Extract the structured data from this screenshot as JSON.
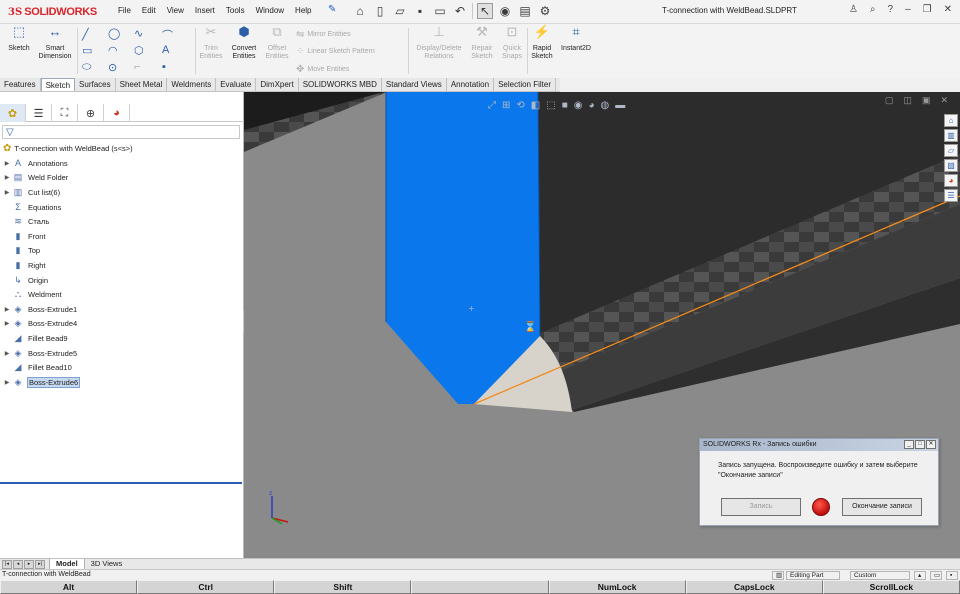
{
  "app": {
    "logo_prefix": "3S",
    "logo_text": "SOLIDWORKS",
    "document_title": "T-connection with WeldBead.SLDPRT"
  },
  "menu": [
    "File",
    "Edit",
    "View",
    "Insert",
    "Tools",
    "Window",
    "Help"
  ],
  "command_manager": {
    "sketch": "Sketch",
    "smart_dimension_1": "Smart",
    "smart_dimension_2": "Dimension",
    "trim_1": "Trim",
    "trim_2": "Entities",
    "convert_1": "Convert",
    "convert_2": "Entities",
    "offset_1": "Offset",
    "offset_2": "Entities",
    "mirror": "Mirror Entities",
    "linear_pattern": "Linear Sketch Pattern",
    "move": "Move Entities",
    "display_delete_1": "Display/Delete",
    "display_delete_2": "Relations",
    "repair_1": "Repair",
    "repair_2": "Sketch",
    "quick_snaps_1": "Quick",
    "quick_snaps_2": "Snaps",
    "rapid_1": "Rapid",
    "rapid_2": "Sketch",
    "instant2d": "Instant2D"
  },
  "tabs": [
    "Features",
    "Sketch",
    "Surfaces",
    "Sheet Metal",
    "Weldments",
    "Evaluate",
    "DimXpert",
    "SOLIDWORKS MBD",
    "Standard Views",
    "Annotation",
    "Selection Filter"
  ],
  "active_tab": "Sketch",
  "feature_tree": {
    "root": "T-connection with WeldBead  (s<s>)",
    "items": [
      {
        "label": "Annotations",
        "expandable": true,
        "icon": "annotations-icon"
      },
      {
        "label": "Weld Folder",
        "expandable": true,
        "icon": "weld-folder-icon"
      },
      {
        "label": "Cut list(6)",
        "expandable": true,
        "icon": "cut-list-icon"
      },
      {
        "label": "Equations",
        "expandable": false,
        "icon": "equations-icon"
      },
      {
        "label": "Сталь",
        "expandable": false,
        "icon": "material-icon"
      },
      {
        "label": "Front",
        "expandable": false,
        "icon": "plane-icon"
      },
      {
        "label": "Top",
        "expandable": false,
        "icon": "plane-icon"
      },
      {
        "label": "Right",
        "expandable": false,
        "icon": "plane-icon"
      },
      {
        "label": "Origin",
        "expandable": false,
        "icon": "origin-icon"
      },
      {
        "label": "Weldment",
        "expandable": false,
        "icon": "weldment-icon"
      },
      {
        "label": "Boss-Extrude1",
        "expandable": true,
        "icon": "extrude-icon"
      },
      {
        "label": "Boss-Extrude4",
        "expandable": true,
        "icon": "extrude-icon"
      },
      {
        "label": "Fillet Bead9",
        "expandable": false,
        "icon": "fillet-bead-icon"
      },
      {
        "label": "Boss-Extrude5",
        "expandable": true,
        "icon": "extrude-icon"
      },
      {
        "label": "Fillet Bead10",
        "expandable": false,
        "icon": "fillet-bead-icon"
      },
      {
        "label": "Boss-Extrude6",
        "expandable": true,
        "icon": "extrude-icon",
        "selected": true
      }
    ]
  },
  "dialog": {
    "title": "SOLIDWORKS Rx - Запись ошибки",
    "message": "Запись запущена. Воспроизведите ошибку и затем выберите \"Окончание записи\"",
    "record_button": "Запись",
    "stop_button": "Окончание записи"
  },
  "bottom_tabs": [
    "Model",
    "3D Views"
  ],
  "active_bottom_tab": "Model",
  "status": {
    "left": "T-connection with WeldBead",
    "mode": "Editing Part",
    "units": "Custom"
  },
  "keys": [
    "Alt",
    "Ctrl",
    "Shift",
    "",
    "NumLock",
    "CapsLock",
    "ScrollLock"
  ],
  "colors": {
    "blue_face": "#0a78ec",
    "dark_face": "#2b2b2b",
    "gray_face": "#8c8c8c",
    "bead": "#d7d3cb",
    "edge": "#f08a1c",
    "background": "#8a8a8a"
  }
}
